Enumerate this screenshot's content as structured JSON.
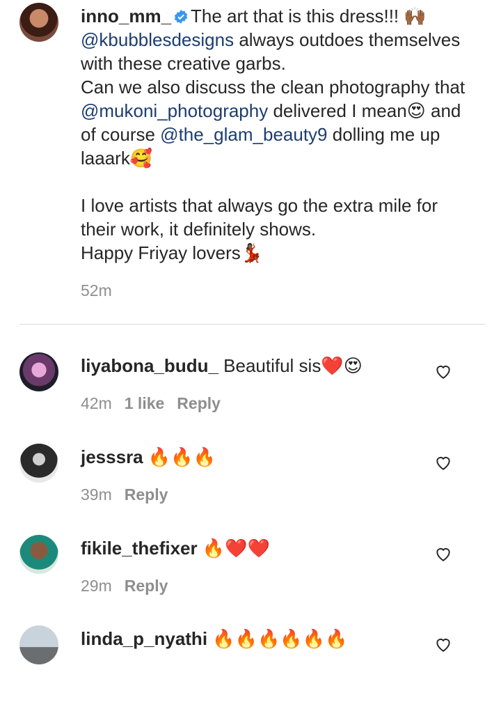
{
  "caption": {
    "username": "inno_mm_",
    "text_line1": "The art that is this dress!!! 🙌🏾",
    "mention1": "@kbubblesdesigns",
    "text_line2": " always outdoes themselves with these creative garbs.",
    "text_line3": "Can we also discuss the clean photography that ",
    "mention2": "@mukoni_photography",
    "text_line4": " delivered I mean😍 and of course ",
    "mention3": "@the_glam_beauty9",
    "text_line5": " dolling me up laaark🥰",
    "para2_line1": "I love artists that always go the extra mile for their work, it definitely shows.",
    "para2_line2": "Happy Friyay lovers💃🏾",
    "time": "52m"
  },
  "comments": [
    {
      "username": "liyabona_budu_",
      "text": " Beautiful sis❤️😍",
      "time": "42m",
      "likes": "1 like",
      "reply": "Reply"
    },
    {
      "username": "jesssra",
      "text": " 🔥🔥🔥",
      "time": "39m",
      "likes": "",
      "reply": "Reply"
    },
    {
      "username": "fikile_thefixer",
      "text": " 🔥❤️❤️",
      "time": "29m",
      "likes": "",
      "reply": "Reply"
    },
    {
      "username": "linda_p_nyathi",
      "text": " 🔥🔥🔥🔥🔥🔥",
      "time": "",
      "likes": "",
      "reply": ""
    }
  ],
  "colors": {
    "mention": "#1c3d70",
    "meta": "#8e8e8e",
    "verified": "#3897f0"
  }
}
